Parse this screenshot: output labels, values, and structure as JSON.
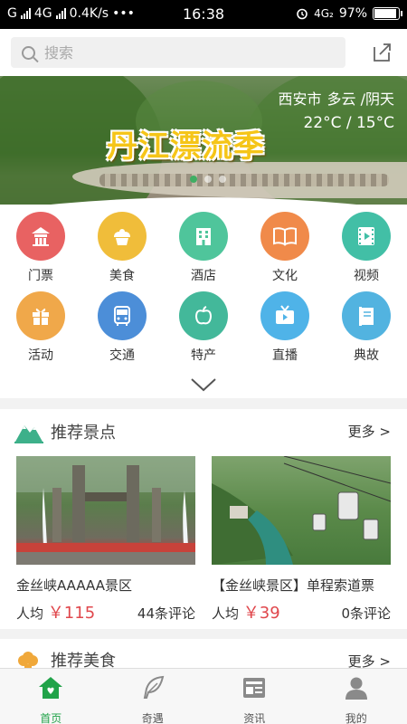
{
  "status_bar": {
    "carrier_left": "G",
    "network": "4G",
    "speed": "0.4K/s",
    "menu_dots": "•••",
    "time": "16:38",
    "network_right": "4G₂",
    "battery": "97%",
    "battery_level": 0.97
  },
  "search": {
    "placeholder": "搜索"
  },
  "banner": {
    "title": "丹江漂流季",
    "city": "西安市",
    "weather": "多云 /阴天",
    "temperature": "22°C / 15°C"
  },
  "categories": [
    {
      "label": "门票",
      "icon": "temple-icon",
      "color": "#e86262"
    },
    {
      "label": "美食",
      "icon": "cupcake-icon",
      "color": "#f0bd3a"
    },
    {
      "label": "酒店",
      "icon": "building-icon",
      "color": "#4fc59b"
    },
    {
      "label": "文化",
      "icon": "book-icon",
      "color": "#f08a4a"
    },
    {
      "label": "视频",
      "icon": "film-icon",
      "color": "#42bfa6"
    },
    {
      "label": "活动",
      "icon": "gift-icon",
      "color": "#f0a84a"
    },
    {
      "label": "交通",
      "icon": "bus-icon",
      "color": "#4c8ed8"
    },
    {
      "label": "特产",
      "icon": "apple-icon",
      "color": "#43b89a"
    },
    {
      "label": "直播",
      "icon": "tv-icon",
      "color": "#4fb3e8"
    },
    {
      "label": "典故",
      "icon": "story-book-icon",
      "color": "#52b3e0"
    }
  ],
  "scenic": {
    "title": "推荐景点",
    "more": "更多 >",
    "cards": [
      {
        "name": "金丝峡AAAAA景区",
        "price_prefix": "人均",
        "price": "￥115",
        "reviews": "44条评论"
      },
      {
        "name": "【金丝峡景区】单程索道票",
        "price_prefix": "人均",
        "price": "￥39",
        "reviews": "0条评论"
      }
    ]
  },
  "food": {
    "title": "推荐美食",
    "more": "更多 >"
  },
  "tabs": [
    {
      "label": "首页",
      "icon": "home-icon",
      "active": true
    },
    {
      "label": "奇遇",
      "icon": "feather-icon",
      "active": false
    },
    {
      "label": "资讯",
      "icon": "news-icon",
      "active": false
    },
    {
      "label": "我的",
      "icon": "user-icon",
      "active": false
    }
  ],
  "colors": {
    "accent_green": "#21a349",
    "price_red": "#e0474c"
  }
}
